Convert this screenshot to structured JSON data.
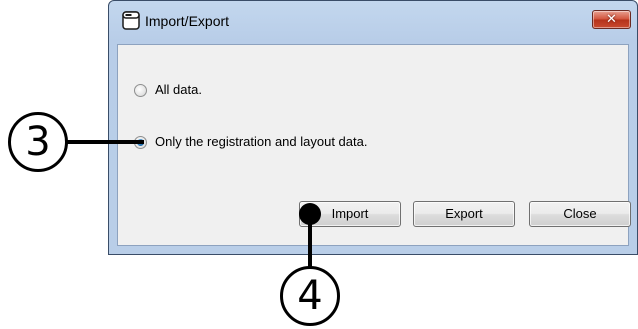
{
  "window": {
    "title": "Import/Export",
    "close_glyph": "✕"
  },
  "options": [
    {
      "label": "All data.",
      "checked": false
    },
    {
      "label": "Only the registration and layout data.",
      "checked": true
    }
  ],
  "buttons": {
    "import": "Import",
    "export": "Export",
    "close": "Close"
  },
  "callouts": [
    {
      "number": "3",
      "target": "option-registration-layout"
    },
    {
      "number": "4",
      "target": "import-button"
    }
  ],
  "colors": {
    "title_bar": "#b9cee8",
    "client_background": "#f0f0f0",
    "close_button": "#c94a2f",
    "radio_selected": "#2577b8",
    "callout": "#000000"
  },
  "icons": {
    "title": "app-window-icon",
    "close": "close-icon"
  }
}
